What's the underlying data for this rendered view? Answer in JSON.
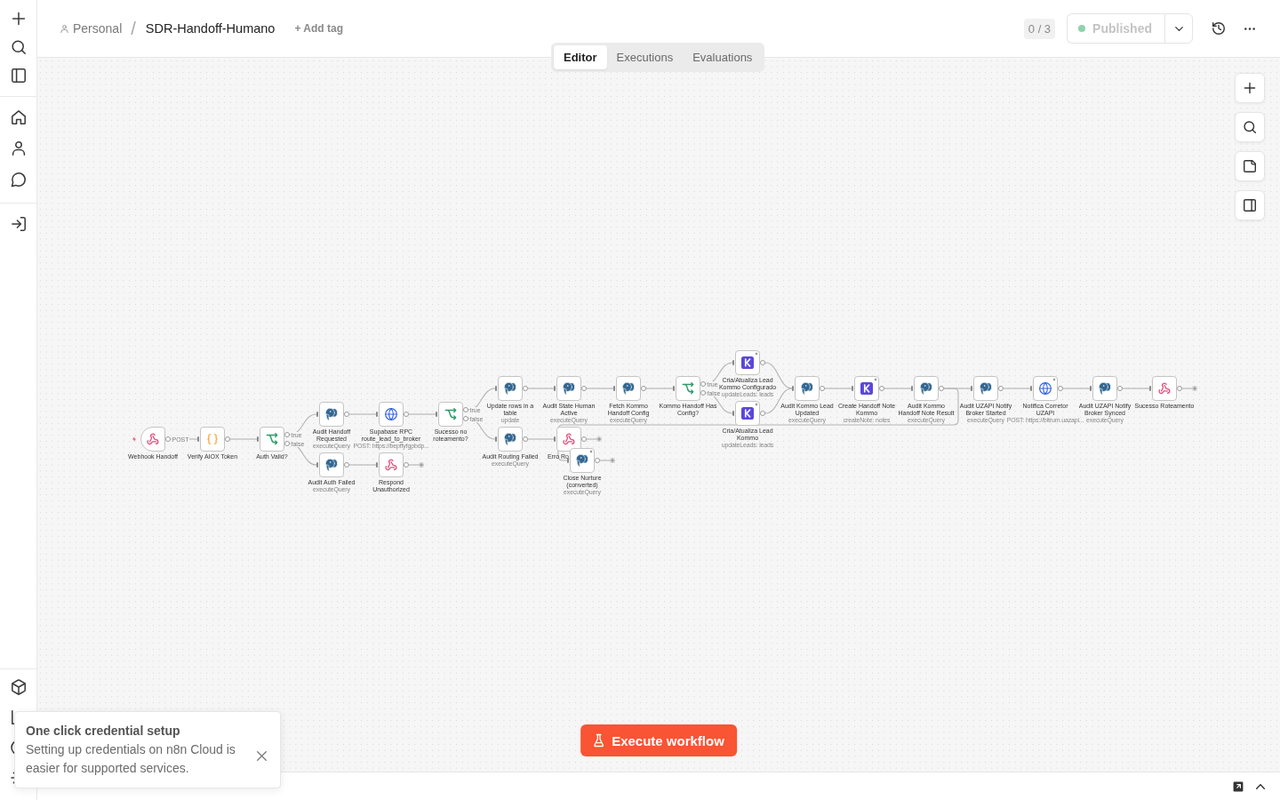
{
  "breadcrumb": {
    "project": "Personal",
    "separator": "/",
    "workflow_name": "SDR-Handoff-Humano",
    "add_tag": "+ Add tag"
  },
  "header_actions": {
    "counter": "0 / 3",
    "publish_button": {
      "label": "Published",
      "disabled": true
    }
  },
  "tabs": [
    {
      "label": "Editor",
      "selected": true
    },
    {
      "label": "Executions",
      "selected": false
    },
    {
      "label": "Evaluations",
      "selected": false
    }
  ],
  "workflow": {
    "nodes": [
      {
        "kind": "webhook",
        "label": "Webhook Handoff",
        "outputs": [
          "POST"
        ],
        "marked": false
      },
      {
        "kind": "code",
        "label": "Verify AIOX Token",
        "marked": false
      },
      {
        "kind": "if",
        "label": "Auth Valid?",
        "outputs": [
          "true",
          "false"
        ],
        "marked": false
      },
      {
        "kind": "postgres",
        "label": "Audit Handoff Requested",
        "subtitle": "executeQuery",
        "marked": false
      },
      {
        "kind": "postgres",
        "label": "Audit Auth Failed",
        "subtitle": "executeQuery",
        "marked": false
      },
      {
        "kind": "http",
        "label": "Supabase RPC route_lead_to_broker",
        "subtitle": "POST: https://bepffyfgpbdp...",
        "marked": false
      },
      {
        "kind": "respond",
        "label": "Respond Unauthorized",
        "marked": false
      },
      {
        "kind": "if",
        "label": "Sucesso no roteamento?",
        "outputs": [
          "true",
          "false"
        ],
        "marked": false
      },
      {
        "kind": "postgres",
        "label": "Update rows in a table",
        "subtitle": "update",
        "marked": false
      },
      {
        "kind": "postgres",
        "label": "Audit Routing Failed",
        "subtitle": "executeQuery",
        "marked": false
      },
      {
        "kind": "postgres",
        "label": "Audit State Human Active",
        "subtitle": "executeQuery",
        "marked": false
      },
      {
        "kind": "respond",
        "label": "Erro Ro",
        "marked": false
      },
      {
        "kind": "postgres",
        "label": "Close Nurture (converted)",
        "subtitle": "executeQuery",
        "marked": true
      },
      {
        "kind": "postgres",
        "label": "Fetch Kommo Handoff Config",
        "subtitle": "executeQuery",
        "marked": false
      },
      {
        "kind": "if",
        "label": "Kommo Handoff Has Config?",
        "outputs": [
          "true",
          "false"
        ],
        "marked": false
      },
      {
        "kind": "kommo",
        "label": "Cria/Atualiza Lead Kommo Configurado",
        "subtitle": "updateLeads: leads",
        "marked": true
      },
      {
        "kind": "kommo",
        "label": "Cria/Atualiza Lead Kommo",
        "subtitle": "updateLeads: leads",
        "marked": true
      },
      {
        "kind": "postgres",
        "label": "Audit Kommo Lead Updated",
        "subtitle": "executeQuery",
        "marked": false
      },
      {
        "kind": "kommo",
        "label": "Create Handoff Note Kommo",
        "subtitle": "createNote: notes",
        "marked": true
      },
      {
        "kind": "postgres",
        "label": "Audit Kommo Handoff Note Result",
        "subtitle": "executeQuery",
        "marked": false
      },
      {
        "kind": "postgres",
        "label": "Audit UZAPI Notify Broker Started",
        "subtitle": "executeQuery",
        "marked": false
      },
      {
        "kind": "http",
        "label": "Notifica Corretor UZAPI",
        "subtitle": "POST: https://bitrum.uazapi...",
        "marked": true
      },
      {
        "kind": "postgres",
        "label": "Audit UZAPI Notify Broker Synced",
        "subtitle": "executeQuery",
        "marked": false
      },
      {
        "kind": "respond",
        "label": "Sucesso Roteamento",
        "marked": false
      }
    ]
  },
  "execute_button": {
    "label": "Execute workflow"
  },
  "toast": {
    "title": "One click credential setup",
    "message": "Setting up credentials on n8n Cloud is easier for supported services."
  }
}
